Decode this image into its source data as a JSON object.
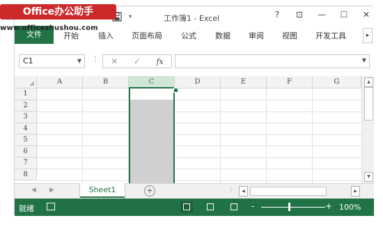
{
  "watermark": {
    "badge": "Office办公助手",
    "url": "www.officezhushou.com"
  },
  "titlebar": {
    "title": "工作簿1 - Excel",
    "controls": [
      "?",
      "⊡",
      "—",
      "☐",
      "✕"
    ]
  },
  "ribbon": {
    "tabs": [
      "文件",
      "开始",
      "插入",
      "页面布局",
      "公式",
      "数据",
      "审阅",
      "视图",
      "开发工具"
    ],
    "scroll_icon": "▸"
  },
  "formula_bar": {
    "name_box": "C1",
    "cancel_icon": "✕",
    "enter_icon": "✓",
    "fx_label": "fx",
    "formula_value": ""
  },
  "grid": {
    "columns": [
      "A",
      "B",
      "C",
      "D",
      "E",
      "F",
      "G"
    ],
    "rows": [
      "1",
      "2",
      "3",
      "4",
      "5",
      "6",
      "7",
      "8"
    ],
    "selected_column": "C",
    "active_cell": "C1"
  },
  "sheets": {
    "tabs": [
      "Sheet1"
    ],
    "active": "Sheet1",
    "add_label": "+"
  },
  "status_bar": {
    "ready": "就绪",
    "zoom_minus": "-",
    "zoom_plus": "+",
    "zoom": "100%",
    "zoom_value": 1.0
  },
  "colors": {
    "accent": "#217346",
    "watermark_red": "#cc2a2a",
    "selection_fill": "#d0d0d0"
  }
}
